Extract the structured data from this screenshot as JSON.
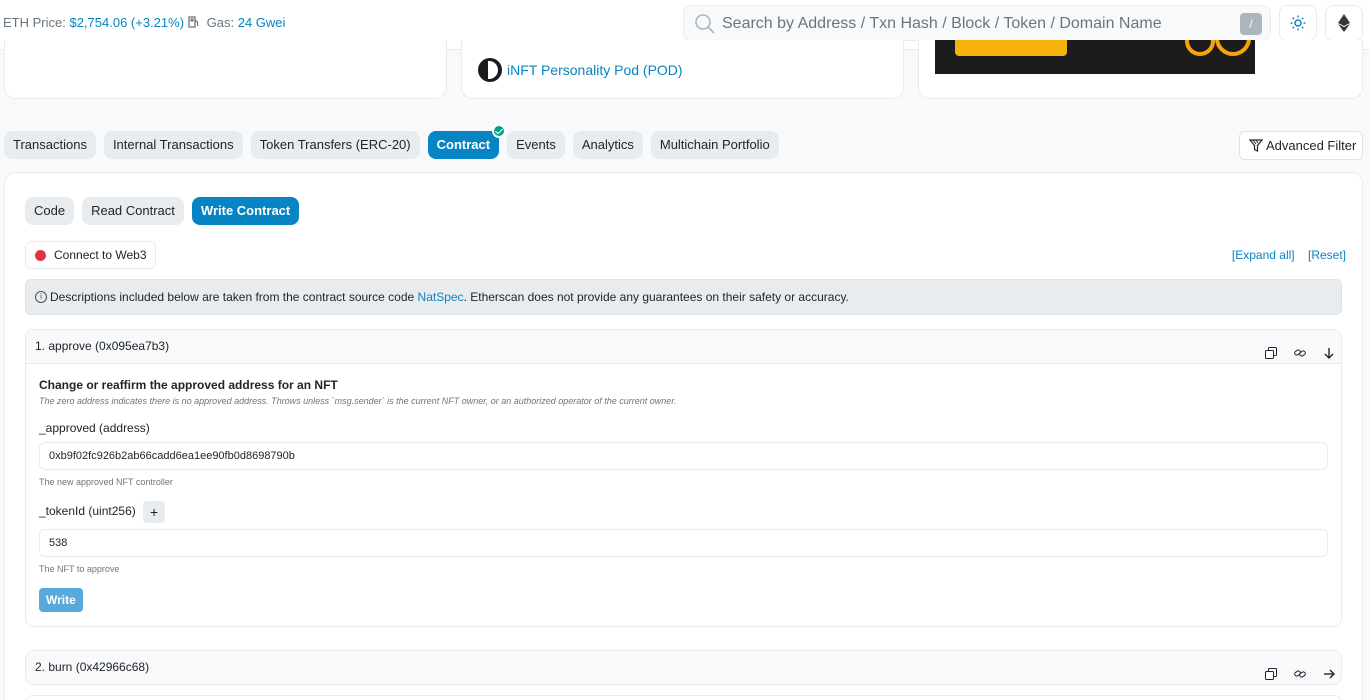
{
  "topbar": {
    "eth_price_label": "ETH Price:",
    "eth_price_value": "$2,754.06 (+3.21%)",
    "gas_label": "Gas:",
    "gas_value": "24 Gwei",
    "search_placeholder": "Search by Address / Txn Hash / Block / Token / Domain Name",
    "search_shortcut": "/"
  },
  "overview": {
    "token_link": "iNFT Personality Pod (POD)"
  },
  "tabs": [
    "Transactions",
    "Internal Transactions",
    "Token Transfers (ERC-20)",
    "Contract",
    "Events",
    "Analytics",
    "Multichain Portfolio"
  ],
  "active_tab": "Contract",
  "advanced_filter": "Advanced Filter",
  "contract": {
    "subtabs": [
      "Code",
      "Read Contract",
      "Write Contract"
    ],
    "active_subtab": "Write Contract",
    "connect": "Connect to Web3",
    "expand_all": "[Expand all]",
    "reset": "[Reset]",
    "notice_prefix": "Descriptions included below are taken from the contract source code ",
    "notice_link": "NatSpec",
    "notice_suffix": ". Etherscan does not provide any guarantees on their safety or accuracy.",
    "functions": [
      {
        "header": "1. approve (0x095ea7b3)",
        "title": "Change or reaffirm the approved address for an NFT",
        "description": "The zero address indicates there is no approved address. Throws unless `msg.sender` is the current NFT owner, or an authorized operator of the current owner.",
        "params": [
          {
            "label": "_approved (address)",
            "value": "0xb9f02fc926b2ab66cadd6ea1ee90fb0d8698790b",
            "hint": "The new approved NFT controller"
          },
          {
            "label": "_tokenId (uint256)",
            "value": "538",
            "hint": "The NFT to approve",
            "plus": "+"
          }
        ],
        "write": "Write"
      },
      {
        "header": "2. burn (0x42966c68)"
      }
    ]
  },
  "colors": {
    "accent": "#0784c3",
    "verified": "#00a186",
    "disconnected": "#dc3545"
  }
}
